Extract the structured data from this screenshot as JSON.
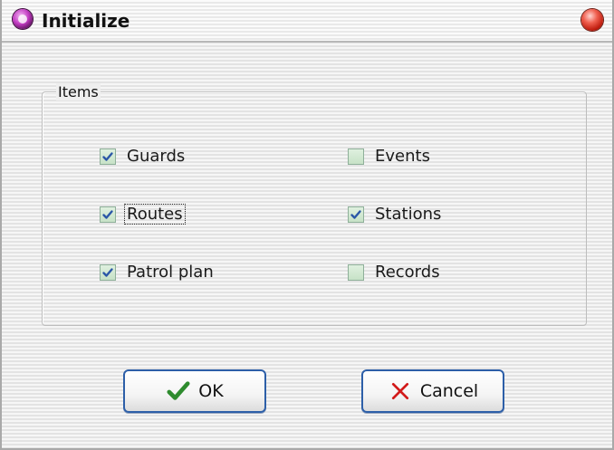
{
  "window": {
    "title": "Initialize"
  },
  "group": {
    "label": "Items",
    "checkboxes": [
      {
        "label": "Guards",
        "checked": true
      },
      {
        "label": "Events",
        "checked": false
      },
      {
        "label": "Routes",
        "checked": true
      },
      {
        "label": "Stations",
        "checked": true
      },
      {
        "label": "Patrol plan",
        "checked": true
      },
      {
        "label": "Records",
        "checked": false
      }
    ]
  },
  "buttons": {
    "ok_label": "OK",
    "cancel_label": "Cancel"
  },
  "colors": {
    "check_mark": "#2b57a7",
    "ok_icon": "#2e8b2e",
    "cancel_icon": "#d21a1a",
    "button_border": "#2d5fa8"
  },
  "icons": {
    "ok": "check-icon",
    "cancel": "x-icon",
    "app": "app-icon",
    "close": "close-icon"
  }
}
